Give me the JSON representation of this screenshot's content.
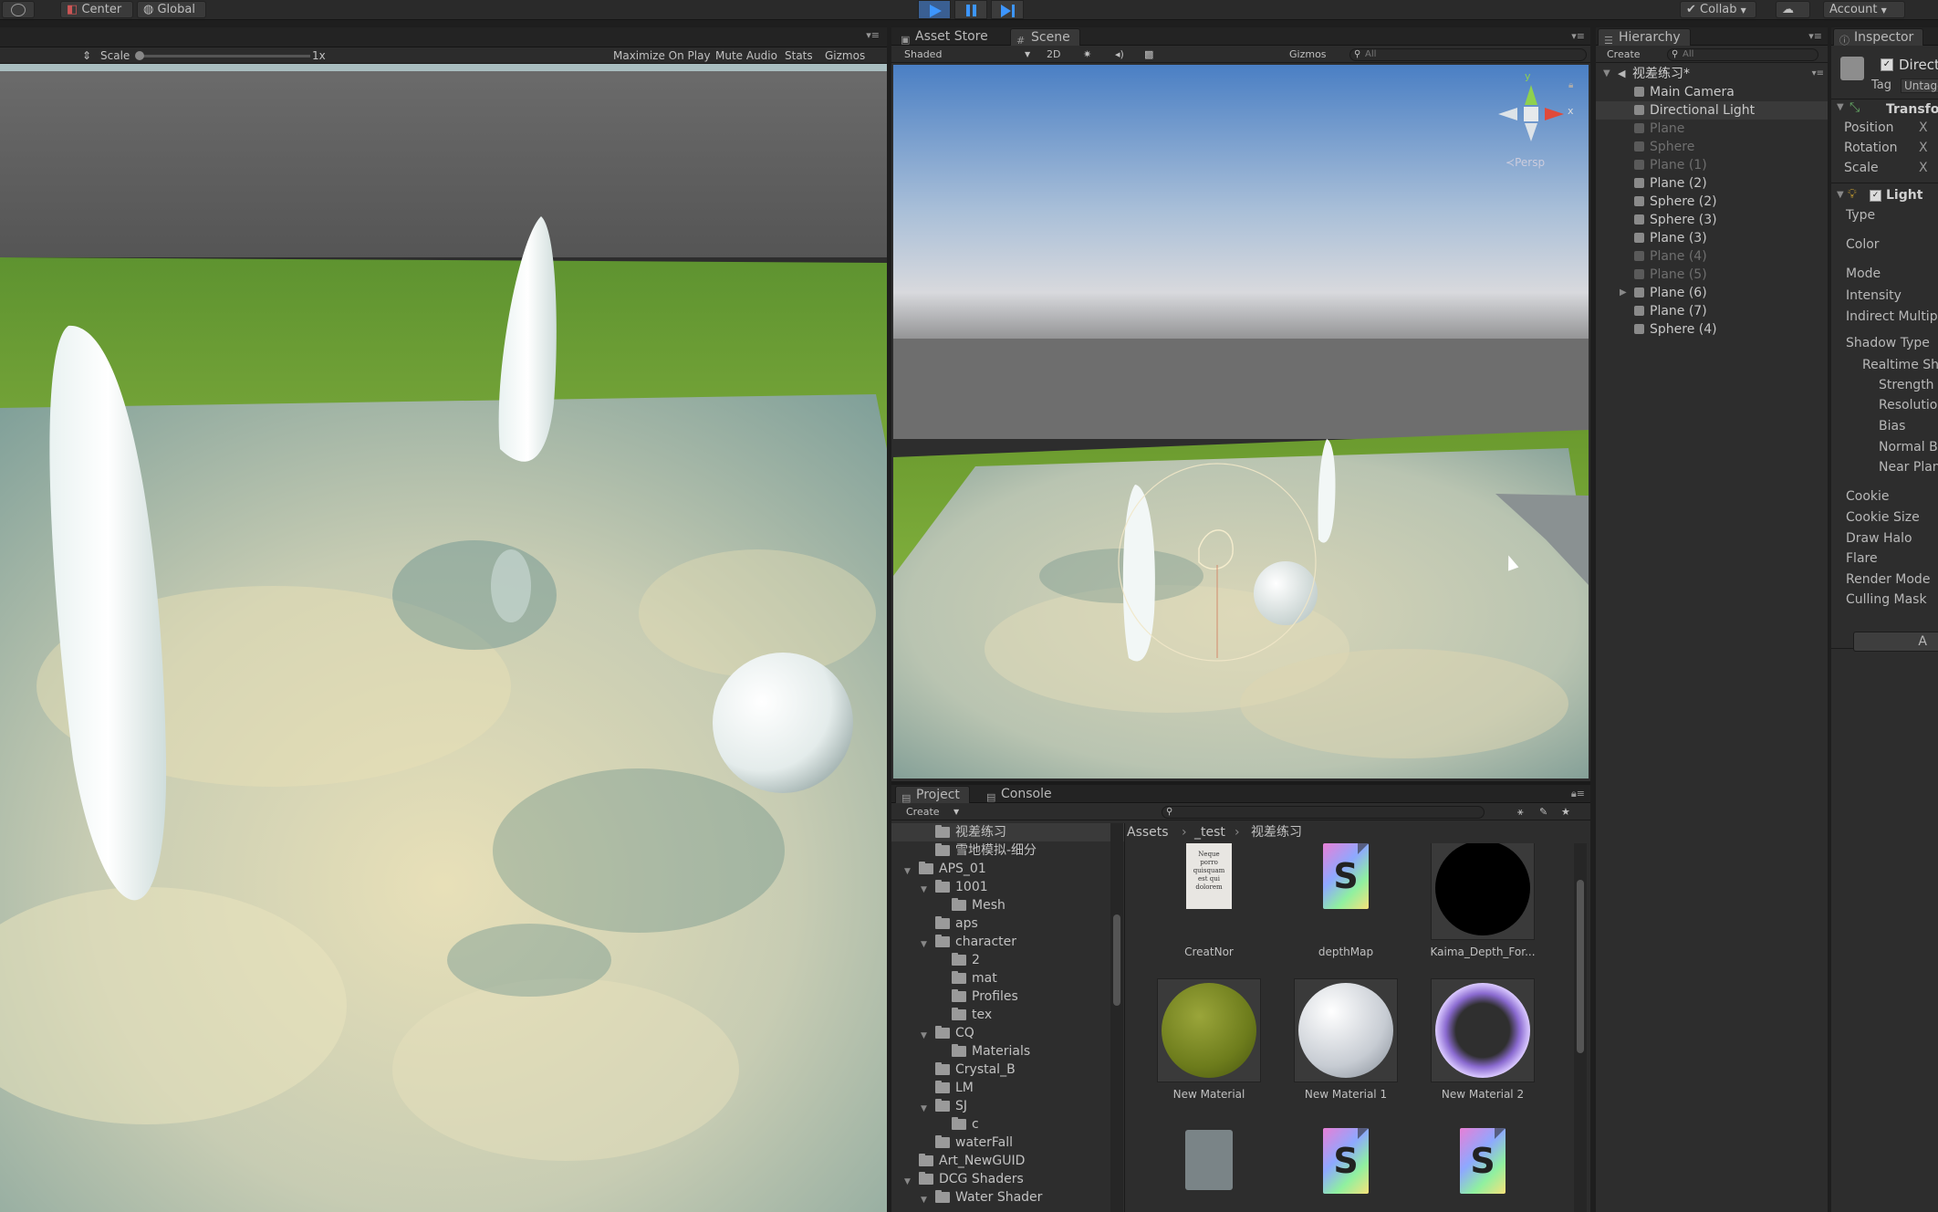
{
  "toolbar": {
    "center_label": "Center",
    "global_label": "Global",
    "collab_label": "Collab",
    "account_label": "Account"
  },
  "game_view": {
    "scale_label": "Scale",
    "scale_value": "1x",
    "maximize_label": "Maximize On Play",
    "mute_label": "Mute Audio",
    "stats_label": "Stats",
    "gizmos_label": "Gizmos"
  },
  "scene_view": {
    "tabs": [
      "Asset Store",
      "Scene"
    ],
    "shading_mode": "Shaded",
    "mode_2d": "2D",
    "gizmos_label": "Gizmos",
    "search_placeholder": "All",
    "persp_label": "Persp",
    "axis_y": "y",
    "axis_x": "x"
  },
  "hierarchy": {
    "tab_label": "Hierarchy",
    "create_label": "Create",
    "search_placeholder": "All",
    "scene_name": "视差练习*",
    "items": [
      {
        "label": "Main Camera",
        "dim": false
      },
      {
        "label": "Directional Light",
        "dim": false,
        "selected": true
      },
      {
        "label": "Plane",
        "dim": true
      },
      {
        "label": "Sphere",
        "dim": true
      },
      {
        "label": "Plane (1)",
        "dim": true
      },
      {
        "label": "Plane (2)",
        "dim": false
      },
      {
        "label": "Sphere (2)",
        "dim": false
      },
      {
        "label": "Sphere (3)",
        "dim": false
      },
      {
        "label": "Plane (3)",
        "dim": false
      },
      {
        "label": "Plane (4)",
        "dim": true
      },
      {
        "label": "Plane (5)",
        "dim": true
      },
      {
        "label": "Plane (6)",
        "dim": false,
        "expandable": true
      },
      {
        "label": "Plane (7)",
        "dim": false
      },
      {
        "label": "Sphere (4)",
        "dim": false
      }
    ]
  },
  "inspector": {
    "tab_label": "Inspector",
    "object_name": "Direct",
    "tag_label": "Tag",
    "tag_value": "Untagg",
    "transform_label": "Transfo",
    "transform_rows": [
      "Position",
      "Rotation",
      "Scale"
    ],
    "axis_x": "X",
    "light_label": "Light",
    "light_rows": [
      "Type",
      "Color",
      "Mode",
      "Intensity",
      "Indirect Multipli",
      "Shadow Type",
      "Realtime Sh",
      "Strength",
      "Resolutio",
      "Bias",
      "Normal B",
      "Near Plan",
      "Cookie",
      "Cookie Size",
      "Draw Halo",
      "Flare",
      "Render Mode",
      "Culling Mask"
    ],
    "add_button": "A"
  },
  "project": {
    "tabs": [
      "Project",
      "Console"
    ],
    "create_label": "Create",
    "breadcrumb": [
      "Assets",
      "_test",
      "视差练习"
    ],
    "tree": [
      {
        "label": "视差练习",
        "indent": 2,
        "arrow": "",
        "selected": true
      },
      {
        "label": "雪地模拟-细分",
        "indent": 2,
        "arrow": ""
      },
      {
        "label": "APS_01",
        "indent": 1,
        "arrow": "▼"
      },
      {
        "label": "1001",
        "indent": 2,
        "arrow": "▼"
      },
      {
        "label": "Mesh",
        "indent": 3,
        "arrow": ""
      },
      {
        "label": "aps",
        "indent": 2,
        "arrow": ""
      },
      {
        "label": "character",
        "indent": 2,
        "arrow": "▼"
      },
      {
        "label": "2",
        "indent": 3,
        "arrow": ""
      },
      {
        "label": "mat",
        "indent": 3,
        "arrow": ""
      },
      {
        "label": "Profiles",
        "indent": 3,
        "arrow": ""
      },
      {
        "label": "tex",
        "indent": 3,
        "arrow": ""
      },
      {
        "label": "CQ",
        "indent": 2,
        "arrow": "▼"
      },
      {
        "label": "Materials",
        "indent": 3,
        "arrow": ""
      },
      {
        "label": "Crystal_B",
        "indent": 2,
        "arrow": ""
      },
      {
        "label": "LM",
        "indent": 2,
        "arrow": ""
      },
      {
        "label": "SJ",
        "indent": 2,
        "arrow": "▼"
      },
      {
        "label": "c",
        "indent": 3,
        "arrow": ""
      },
      {
        "label": "waterFall",
        "indent": 2,
        "arrow": ""
      },
      {
        "label": "Art_NewGUID",
        "indent": 1,
        "arrow": ""
      },
      {
        "label": "DCG Shaders",
        "indent": 1,
        "arrow": "▼"
      },
      {
        "label": "Water Shader",
        "indent": 2,
        "arrow": "▼"
      }
    ],
    "assets": [
      {
        "label": "CreatNor",
        "kind": "texture-doc",
        "doc_text": "Neque porro quisquam est qui dolorem"
      },
      {
        "label": "depthMap",
        "kind": "shader"
      },
      {
        "label": "Kaima_Depth_For...",
        "kind": "black-sphere"
      },
      {
        "label": "New Material",
        "kind": "green-sphere"
      },
      {
        "label": "New Material 1",
        "kind": "white-sphere"
      },
      {
        "label": "New Material 2",
        "kind": "purple-sphere"
      },
      {
        "label": "",
        "kind": "graph"
      },
      {
        "label": "",
        "kind": "shader"
      },
      {
        "label": "",
        "kind": "shader"
      }
    ]
  },
  "colors": {
    "accent": "#3a5f92",
    "panel": "#2d2d2d",
    "tab_strip": "#232323",
    "selected_row": "#3a3a3a"
  }
}
